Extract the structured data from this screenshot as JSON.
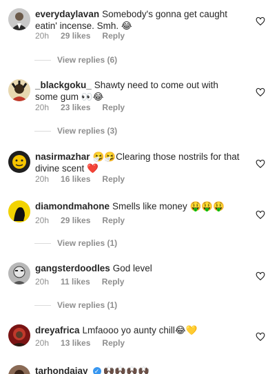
{
  "comments": [
    {
      "username": "everydaylavan",
      "text": "Somebody's gonna get caught eatin' incense. Smh. 😂",
      "time": "20h",
      "likes": "29 likes",
      "reply": "Reply",
      "view_replies": "View replies (6)"
    },
    {
      "username": "_blackgoku_",
      "text": "Shawty need to come out with some gum 👀😂",
      "time": "20h",
      "likes": "23 likes",
      "reply": "Reply",
      "view_replies": "View replies (3)"
    },
    {
      "username": "nasirmazhar",
      "text": "🤧🤧Clearing those nostrils for that divine scent ❤️",
      "time": "20h",
      "likes": "16 likes",
      "reply": "Reply"
    },
    {
      "username": "diamondmahone",
      "text": "Smells like money 🤑🤑🤑",
      "time": "20h",
      "likes": "29 likes",
      "reply": "Reply",
      "view_replies": "View replies (1)"
    },
    {
      "username": "gangsterdoodles",
      "text": "God level",
      "time": "20h",
      "likes": "11 likes",
      "reply": "Reply",
      "view_replies": "View replies (1)"
    },
    {
      "username": "dreyafrica",
      "text": "Lmfaooo yo aunty chill😂💛",
      "time": "20h",
      "likes": "13 likes",
      "reply": "Reply"
    },
    {
      "username": "tarhondajay",
      "text": "🙌🏿🙌🏿🙌🏿🙌🏿"
    }
  ]
}
